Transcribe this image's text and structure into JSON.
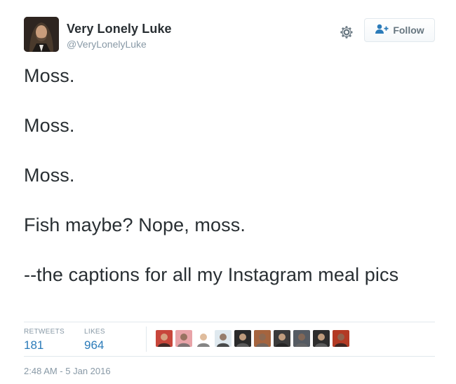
{
  "user": {
    "display_name": "Very Lonely Luke",
    "handle": "@VeryLonelyLuke",
    "avatar_icon": "profile-photo"
  },
  "actions": {
    "settings_icon": "gear-icon",
    "follow_icon": "add-user-icon",
    "follow_label": "Follow"
  },
  "tweet": {
    "lines": [
      "Moss.",
      "Moss.",
      "Moss.",
      "Fish maybe? Nope, moss.",
      "--the captions for all my Instagram meal pics"
    ]
  },
  "stats": {
    "retweets_label": "RETWEETS",
    "retweets_count": "181",
    "likes_label": "LIKES",
    "likes_count": "964"
  },
  "likers": [
    {
      "name": "liker-avatar-1",
      "color": "#c8463b"
    },
    {
      "name": "liker-avatar-2",
      "color": "#e8a3a8"
    },
    {
      "name": "liker-avatar-3",
      "color": "#ffffff"
    },
    {
      "name": "liker-avatar-4",
      "color": "#dfe9ef"
    },
    {
      "name": "liker-avatar-5",
      "color": "#2a2a2a"
    },
    {
      "name": "liker-avatar-6",
      "color": "#a5643e"
    },
    {
      "name": "liker-avatar-7",
      "color": "#3b3b3b"
    },
    {
      "name": "liker-avatar-8",
      "color": "#555b63"
    },
    {
      "name": "liker-avatar-9",
      "color": "#2d2d2d"
    },
    {
      "name": "liker-avatar-10",
      "color": "#b33a24"
    }
  ],
  "timestamp": "2:48 AM - 5 Jan 2016",
  "colors": {
    "link_blue": "#2b7bb9",
    "muted": "#8899a6",
    "text": "#292f33",
    "border": "#e1e8ed"
  }
}
